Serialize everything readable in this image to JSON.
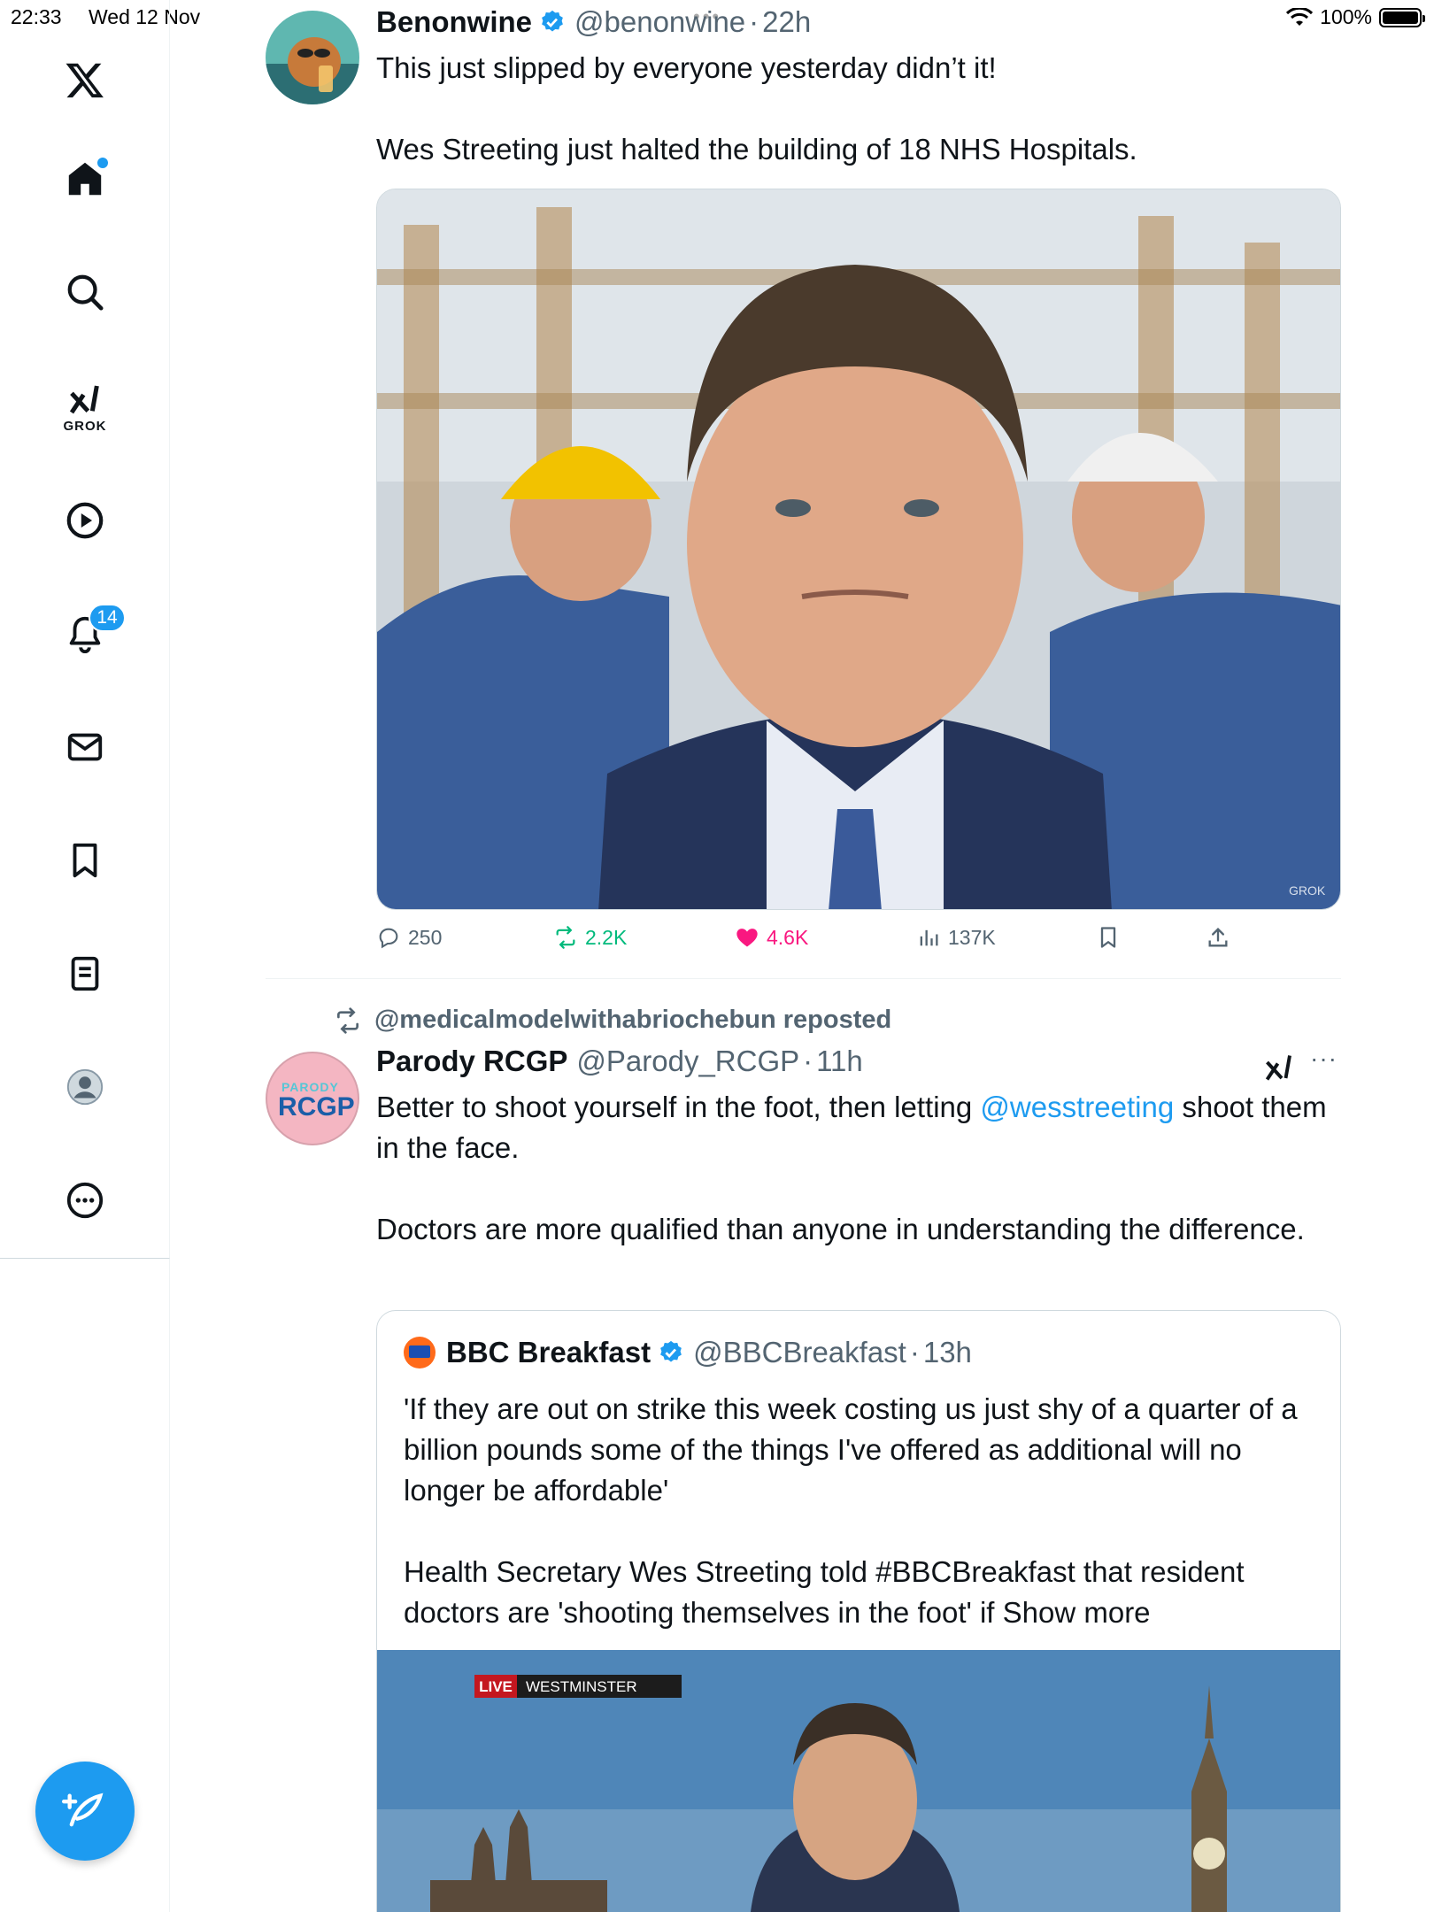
{
  "status_bar": {
    "time": "22:33",
    "date": "Wed 12 Nov",
    "battery": "100%"
  },
  "sidebar": {
    "items": [
      {
        "name": "X",
        "icon": "x-logo-icon"
      },
      {
        "name": "Home",
        "icon": "home-icon"
      },
      {
        "name": "Search",
        "icon": "search-icon"
      },
      {
        "name": "Grok",
        "icon": "grok-icon",
        "label": "GROK"
      },
      {
        "name": "Videos",
        "icon": "play-icon"
      },
      {
        "name": "Notifications",
        "icon": "bell-icon",
        "badge": "14"
      },
      {
        "name": "Messages",
        "icon": "mail-icon"
      },
      {
        "name": "Bookmarks",
        "icon": "bookmark-icon"
      },
      {
        "name": "Lists",
        "icon": "list-icon"
      },
      {
        "name": "Profile",
        "icon": "profile-icon"
      },
      {
        "name": "More",
        "icon": "more-icon"
      }
    ],
    "compose_icon": "compose-icon"
  },
  "post1": {
    "name": "Benonwine",
    "handle": "@benonwine",
    "time": "22h",
    "text": "This just slipped by everyone yesterday didn’t it!\n\nWes Streeting just halted the building of 18 NHS Hospitals.",
    "image_watermark": "GROK",
    "actions": {
      "replies": "250",
      "reposts": "2.2K",
      "likes": "4.6K",
      "views": "137K"
    }
  },
  "post2": {
    "reposted_by": "@medicalmodelwithabriochebun reposted",
    "name": "Parody RCGP",
    "handle": "@Parody_RCGP",
    "time": "11h",
    "avatar_top": "PARODY",
    "avatar_main": "RCGP",
    "text_before": "Better to shoot yourself in the foot, then letting ",
    "mention": "@wesstreeting",
    "text_after": " shoot them in the face.\n\nDoctors are more qualified than anyone in understanding the difference.",
    "quote": {
      "name": "BBC Breakfast",
      "handle": "@BBCBreakfast",
      "time": "13h",
      "text": "'If they are out on strike this week costing us just shy of a quarter of a billion pounds some of the things I've offered as additional will no longer be affordable'\n\nHealth Secretary Wes Streeting told #BBCBreakfast that resident doctors are 'shooting themselves in the foot' if Show more",
      "live": "LIVE",
      "location": "WESTMINSTER"
    }
  },
  "dot_separator": "·"
}
